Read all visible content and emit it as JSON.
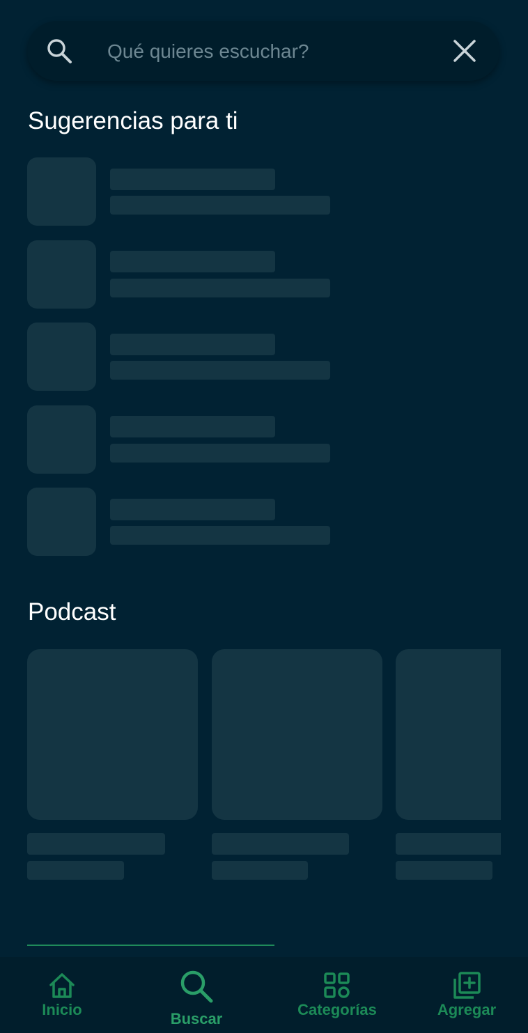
{
  "search": {
    "placeholder": "Qué quieres escuchar?",
    "value": "",
    "icon": "search-icon",
    "clear_icon": "close-icon"
  },
  "sections": {
    "suggestions_title": "Sugerencias para ti",
    "podcast_title": "Podcast"
  },
  "bottom_nav": {
    "items": [
      {
        "label": "Inicio",
        "icon": "home-icon"
      },
      {
        "label": "Buscar",
        "icon": "search-icon",
        "active": true
      },
      {
        "label": "Categorías",
        "icon": "grid-icon"
      },
      {
        "label": "Agregar",
        "icon": "add-library-icon"
      }
    ]
  },
  "colors": {
    "background": "#012233",
    "skeleton": "#143543",
    "accent": "#1c8a57",
    "accent_active": "#2a9e68",
    "text": "#ffffff",
    "placeholder": "#6d8792"
  }
}
